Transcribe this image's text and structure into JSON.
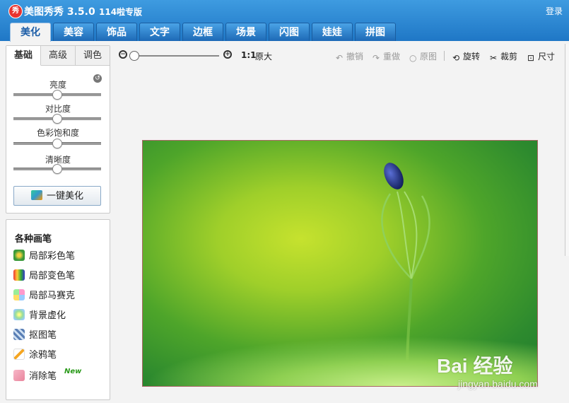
{
  "app": {
    "logo_text": "秀",
    "title": "美图秀秀 3.5.0",
    "subtitle": "114啦专版",
    "login": "登录"
  },
  "main_tabs": [
    {
      "label": "美化",
      "active": true
    },
    {
      "label": "美容"
    },
    {
      "label": "饰品"
    },
    {
      "label": "文字"
    },
    {
      "label": "边框"
    },
    {
      "label": "场景"
    },
    {
      "label": "闪图"
    },
    {
      "label": "娃娃"
    },
    {
      "label": "拼图"
    }
  ],
  "sub_tabs": [
    {
      "label": "基础",
      "active": true
    },
    {
      "label": "高级"
    },
    {
      "label": "调色"
    }
  ],
  "sliders": [
    {
      "label": "亮度",
      "value": 0.5
    },
    {
      "label": "对比度",
      "value": 0.5
    },
    {
      "label": "色彩饱和度",
      "value": 0.5
    },
    {
      "label": "清晰度",
      "value": 0.5
    }
  ],
  "one_key_button": "一键美化",
  "brushes": {
    "title": "各种画笔",
    "items": [
      {
        "label": "局部彩色笔",
        "icon": "color-pen-icon"
      },
      {
        "label": "局部变色笔",
        "icon": "recolor-pen-icon"
      },
      {
        "label": "局部马赛克",
        "icon": "mosaic-icon"
      },
      {
        "label": "背景虚化",
        "icon": "blur-icon"
      },
      {
        "label": "抠图笔",
        "icon": "cutout-icon"
      },
      {
        "label": "涂鸦笔",
        "icon": "doodle-icon"
      },
      {
        "label": "消除笔",
        "icon": "eraser-icon",
        "badge": "New"
      }
    ]
  },
  "toolbar": {
    "ratio": "1:1",
    "original_size": "原大",
    "undo": "撤销",
    "redo": "重做",
    "original": "原图",
    "rotate": "旋转",
    "crop": "裁剪",
    "resize": "尺寸"
  },
  "zoom": {
    "value": 0.0
  },
  "watermark": {
    "main": "Bai 经验",
    "sub": "jingyan.baidu.com"
  }
}
